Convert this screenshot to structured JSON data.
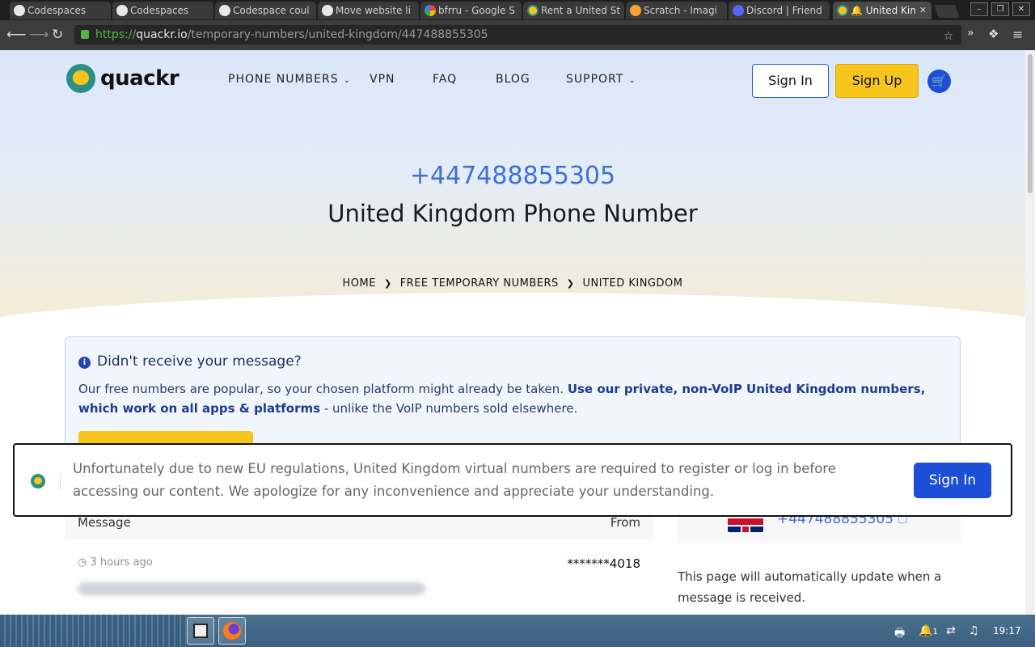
{
  "browser": {
    "tabs": [
      {
        "title": "Codespaces",
        "icon": "github-icon"
      },
      {
        "title": "Codespaces",
        "icon": "github-icon"
      },
      {
        "title": "Codespace coul",
        "icon": "github-icon"
      },
      {
        "title": "Move website li",
        "icon": "github-icon"
      },
      {
        "title": "bfrru - Google S",
        "icon": "google-icon"
      },
      {
        "title": "Rent a United St",
        "icon": "quackr-icon"
      },
      {
        "title": "Scratch - Imagi",
        "icon": "scratch-icon"
      },
      {
        "title": "Discord | Friend",
        "icon": "discord-icon"
      },
      {
        "title": "🔔 United Kin",
        "icon": "quackr-icon",
        "active": true
      }
    ],
    "close_glyph": "✕",
    "url_scheme": "https://",
    "url_host": "quackr.io",
    "url_path": "/temporary-numbers/united-kingdom/447488855305"
  },
  "header": {
    "logo_text": "quackr",
    "nav": [
      {
        "label": "PHONE NUMBERS",
        "has_dropdown": true
      },
      {
        "label": "VPN",
        "has_dropdown": false
      },
      {
        "label": "FAQ",
        "has_dropdown": false
      },
      {
        "label": "BLOG",
        "has_dropdown": false
      },
      {
        "label": "SUPPORT",
        "has_dropdown": true
      }
    ],
    "sign_in": "Sign In",
    "sign_up": "Sign Up"
  },
  "hero": {
    "phone_number": "+447488855305",
    "title": "United Kingdom Phone Number",
    "breadcrumbs": [
      "HOME",
      "FREE TEMPORARY NUMBERS",
      "UNITED KINGDOM"
    ]
  },
  "notice": {
    "heading": "Didn't receive your message?",
    "body_plain": "Our free numbers are popular, so your chosen platform might already be taken. ",
    "body_bold": "Use our private, non-VoIP United Kingdom numbers, which work on all apps & platforms",
    "body_tail": " - unlike the VoIP numbers sold elsewhere."
  },
  "messages": {
    "col_message": "Message",
    "col_from": "From",
    "rows": [
      {
        "time": "3 hours ago",
        "from": "*******4018"
      }
    ]
  },
  "sidebar": {
    "number": "+447488855305",
    "note": "This page will automatically update when a message is received."
  },
  "banner": {
    "text": "Unfortunately due to new EU regulations, United Kingdom virtual numbers are required to register or log in before accessing our content. We apologize for any inconvenience and appreciate your understanding.",
    "button": "Sign In"
  },
  "taskbar": {
    "clock": "19:17",
    "notif_count": "1"
  },
  "colors": {
    "accent_blue": "#1c4fd6",
    "brand_yellow": "#f8c51c",
    "number_blue": "#3f6fd8"
  }
}
